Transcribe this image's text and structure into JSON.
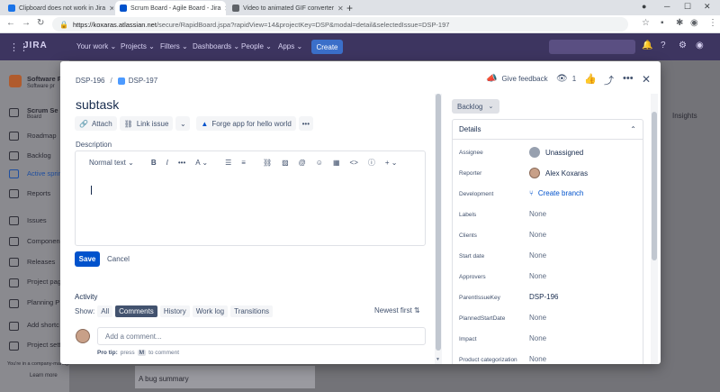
{
  "browser": {
    "tabs": [
      {
        "title": "Clipboard does not work in Jira",
        "icon_color": "#1a73e8"
      },
      {
        "title": "Scrum Board - Agile Board - Jira",
        "icon_color": "#0052cc"
      },
      {
        "title": "Video to animated GIF converter",
        "icon_color": "#5f6368"
      }
    ],
    "url_host": "https://koxaras.atlassian.net",
    "url_rest": "/secure/RapidBoard.jspa?rapidView=14&projectKey=DSP&modal=detail&selectedIssue=DSP-197"
  },
  "jira": {
    "logo": "JIRA",
    "nav": [
      "Your work ⌄",
      "Projects ⌄",
      "Filters ⌄",
      "Dashboards ⌄",
      "People ⌄",
      "Apps ⌄"
    ],
    "create_label": "Create",
    "sidebar": {
      "project_name": "Software P",
      "project_sub": "Software pr",
      "items": [
        "Scrum Se",
        "Board",
        "Roadmap",
        "Backlog",
        "Active sprin",
        "Reports",
        "Issues",
        "Componen",
        "Releases",
        "Project pag",
        "Planning P",
        "Add shortc",
        "Project setti"
      ],
      "footer": "You're in a company-managed project",
      "learn_more": "Learn more"
    },
    "bg_card": "A bug summary",
    "insights": "Insights"
  },
  "modal": {
    "breadcrumb_parent": "DSP-196",
    "breadcrumb_current": "DSP-197",
    "give_feedback": "Give feedback",
    "watch_count": "1",
    "title": "subtask",
    "actions": {
      "attach": "Attach",
      "link_issue": "Link issue",
      "forge_app": "Forge app for hello world"
    },
    "description_label": "Description",
    "editor": {
      "text_style": "Normal text"
    },
    "save": "Save",
    "cancel": "Cancel",
    "activity": {
      "label": "Activity",
      "show": "Show:",
      "filters": [
        "All",
        "Comments",
        "History",
        "Work log",
        "Transitions"
      ],
      "selected": "Comments",
      "sort": "Newest first",
      "comment_placeholder": "Add a comment...",
      "protip_label": "Pro tip:",
      "protip_press": "press",
      "protip_key": "M",
      "protip_tail": "to comment"
    },
    "status": "Backlog",
    "details": {
      "title": "Details",
      "fields": [
        {
          "label": "Assignee",
          "value": "Unassigned"
        },
        {
          "label": "Reporter",
          "value": "Alex Koxaras"
        },
        {
          "label": "Development",
          "value": "Create branch"
        },
        {
          "label": "Labels",
          "value": "None"
        },
        {
          "label": "Clients",
          "value": "None"
        },
        {
          "label": "Start date",
          "value": "None"
        },
        {
          "label": "Approvers",
          "value": "None"
        },
        {
          "label": "ParentIssueKey",
          "value": "DSP-196"
        },
        {
          "label": "PlannedStartDate",
          "value": "None"
        },
        {
          "label": "Impact",
          "value": "None"
        },
        {
          "label": "Product categorization",
          "value": "None"
        }
      ]
    }
  }
}
